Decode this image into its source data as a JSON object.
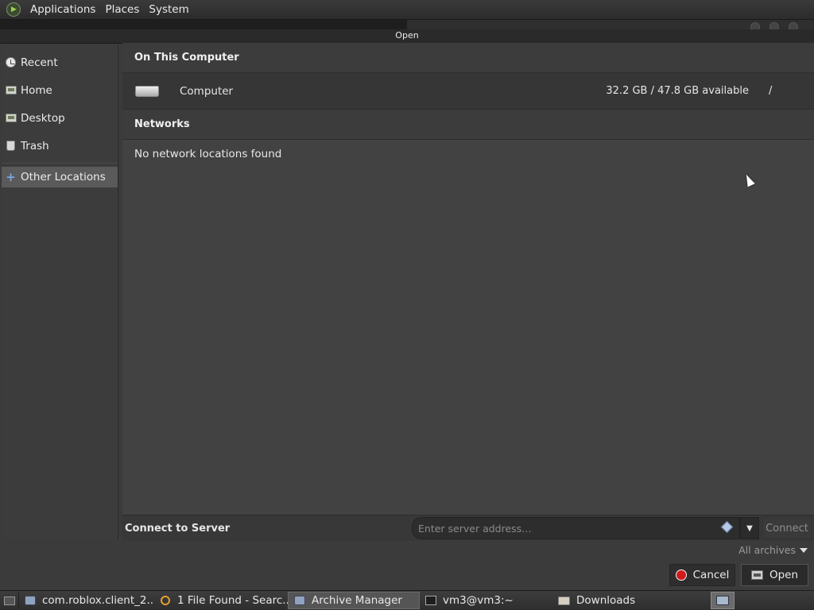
{
  "topbar": {
    "menus": [
      "Applications",
      "Places",
      "System"
    ]
  },
  "dialog": {
    "title": "Open",
    "sidebar": {
      "items": [
        {
          "label": "Recent",
          "icon": "recent-icon"
        },
        {
          "label": "Home",
          "icon": "home-folder-icon"
        },
        {
          "label": "Desktop",
          "icon": "desktop-folder-icon"
        },
        {
          "label": "Trash",
          "icon": "trash-icon"
        }
      ],
      "other_locations": {
        "label": "Other Locations",
        "icon": "plus-icon",
        "selected": true
      }
    },
    "main": {
      "on_this_computer": "On This Computer",
      "computer": {
        "name": "Computer",
        "available": "32.2 GB / 47.8 GB available",
        "mount": "/"
      },
      "networks": "Networks",
      "no_network": "No network locations found"
    },
    "connect": {
      "label": "Connect to Server",
      "placeholder": "Enter server address…",
      "button": "Connect"
    },
    "filter": {
      "selected": "All archives"
    },
    "buttons": {
      "cancel": "Cancel",
      "open": "Open"
    }
  },
  "taskbar": {
    "tasks": [
      {
        "label": "com.roblox.client_2....",
        "icon": "archive-icon",
        "active": false
      },
      {
        "label": "1 File Found - Searc...",
        "icon": "search-icon",
        "active": false
      },
      {
        "label": "Archive Manager",
        "icon": "archive-icon",
        "active": true
      },
      {
        "label": "vm3@vm3:~",
        "icon": "terminal-icon",
        "active": false
      },
      {
        "label": "Downloads",
        "icon": "folder-icon",
        "active": false
      }
    ]
  },
  "colors": {
    "background": "#3b3b3b",
    "selection": "#5a5a5a",
    "cancel_icon": "#cf1b1b"
  }
}
